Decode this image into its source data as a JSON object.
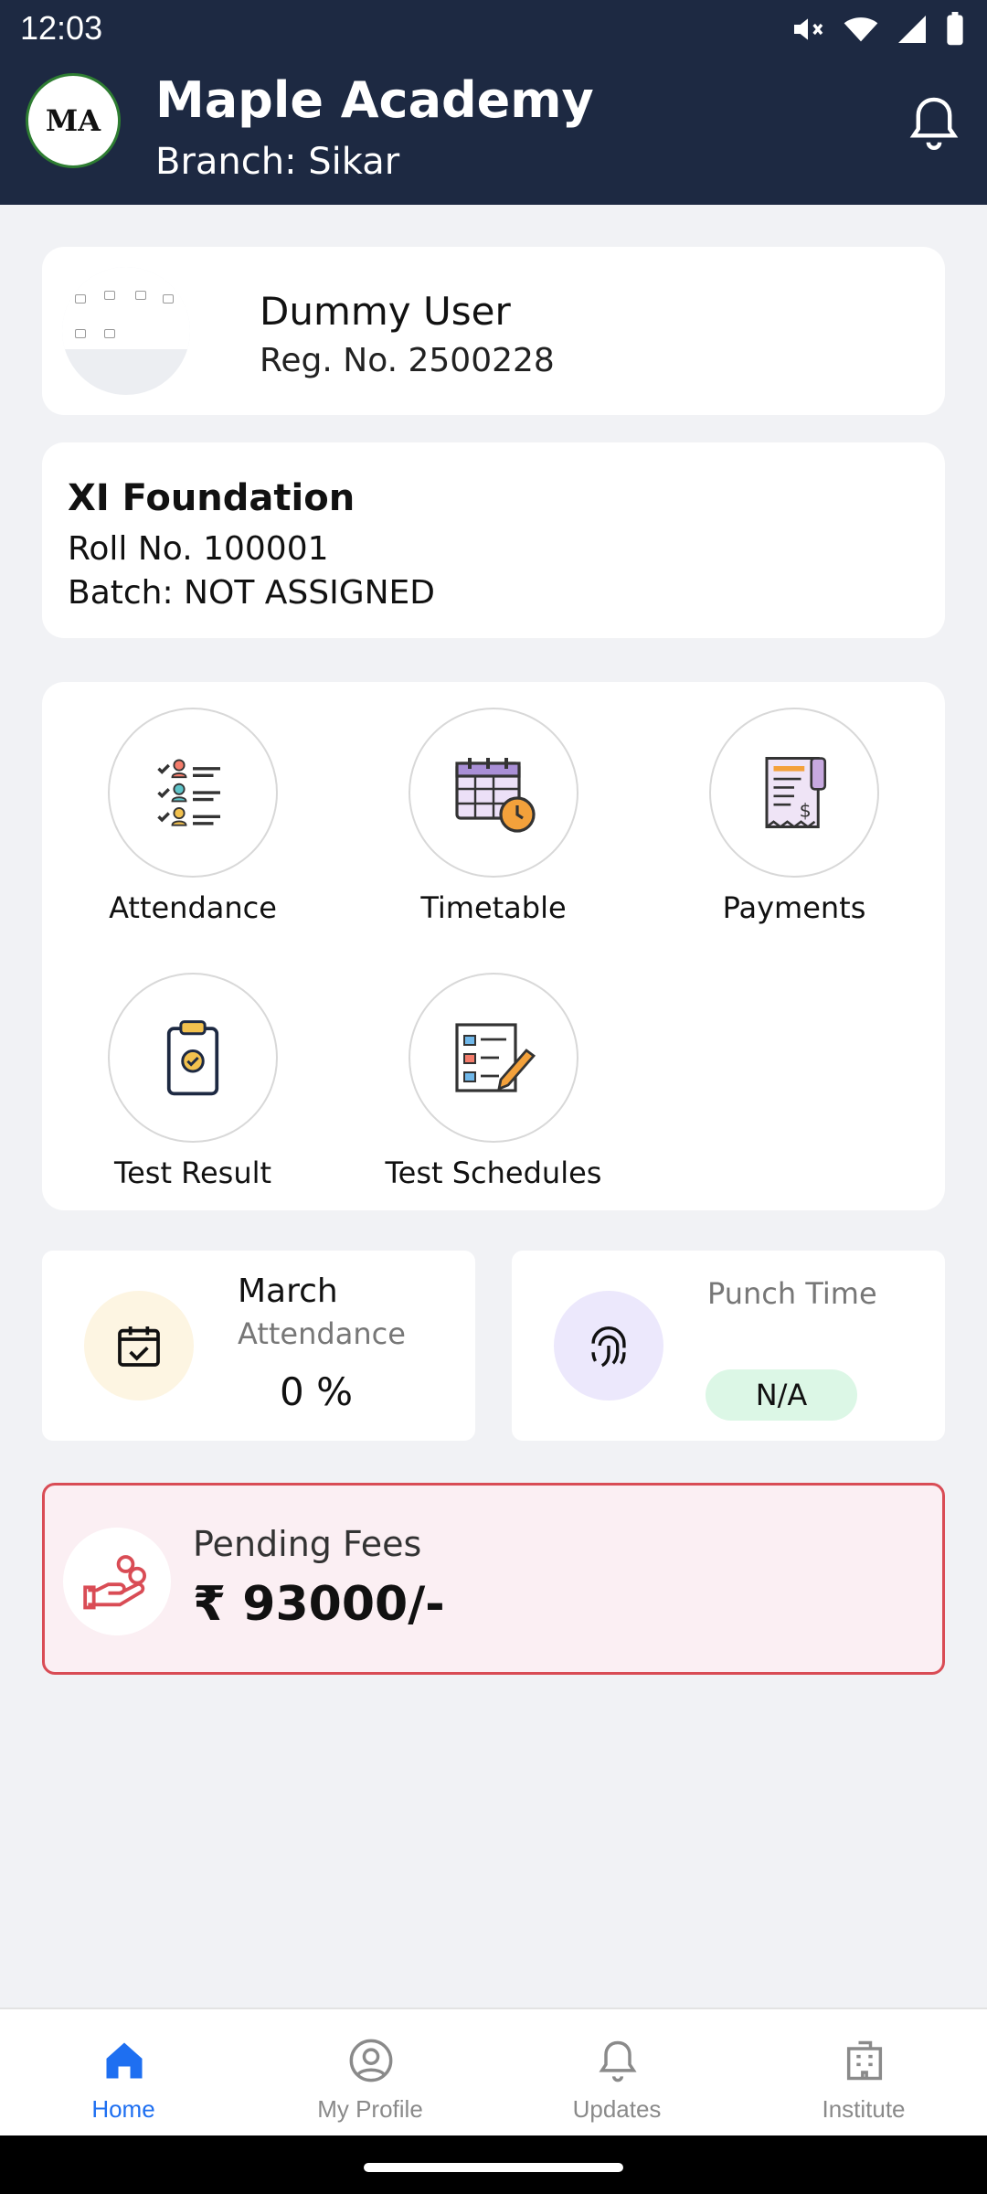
{
  "status_bar": {
    "time": "12:03"
  },
  "header": {
    "logo_text": "MA",
    "title": "Maple Academy",
    "branch": "Branch: Sikar"
  },
  "profile": {
    "name": "Dummy User",
    "reg_no": "Reg. No. 2500228"
  },
  "class_info": {
    "title": "XI Foundation",
    "roll_no": "Roll No. 100001",
    "batch": "Batch: NOT ASSIGNED"
  },
  "menu": {
    "items": [
      {
        "label": "Attendance",
        "icon": "attendance-list-icon"
      },
      {
        "label": "Timetable",
        "icon": "calendar-clock-icon"
      },
      {
        "label": "Payments",
        "icon": "receipt-icon"
      },
      {
        "label": "Test Result",
        "icon": "clipboard-check-icon"
      },
      {
        "label": "Test Schedules",
        "icon": "checklist-pencil-icon"
      }
    ]
  },
  "attendance_stat": {
    "month": "March",
    "label": "Attendance",
    "value": "0 %",
    "icon": "calendar-check-icon",
    "icon_bg": "#fdf5e2"
  },
  "punch_stat": {
    "label": "Punch Time",
    "value": "N/A",
    "icon": "fingerprint-icon",
    "icon_bg": "#ece8fc"
  },
  "fees": {
    "label": "Pending Fees",
    "amount": "₹ 93000/-",
    "icon": "hand-coins-icon",
    "accent": "#d94c55"
  },
  "bottom_nav": {
    "items": [
      {
        "label": "Home",
        "icon": "home-icon",
        "active": true
      },
      {
        "label": "My Profile",
        "icon": "profile-icon",
        "active": false
      },
      {
        "label": "Updates",
        "icon": "bell-icon",
        "active": false
      },
      {
        "label": "Institute",
        "icon": "building-icon",
        "active": false
      }
    ],
    "active_color": "#1e6ff1"
  },
  "colors": {
    "header_bg": "#1d2942",
    "page_bg": "#f1f2f5"
  }
}
